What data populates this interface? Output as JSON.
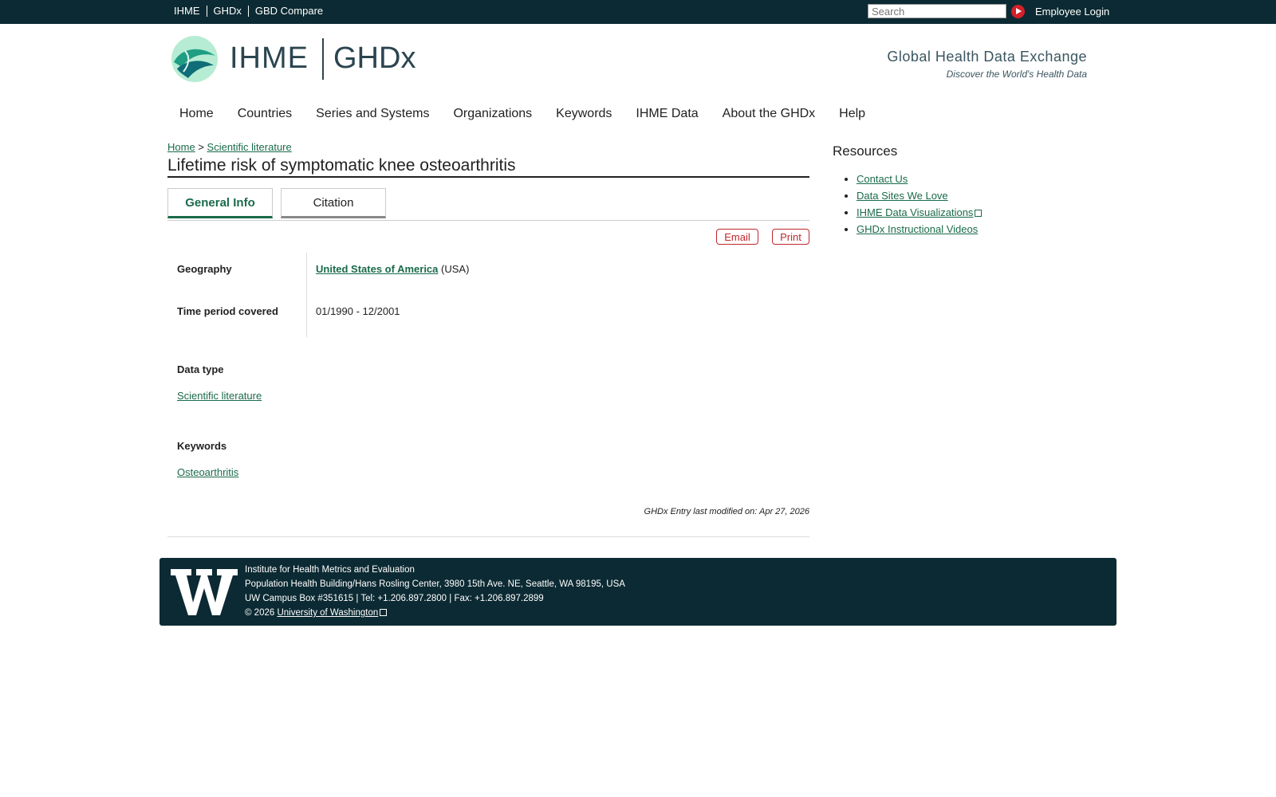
{
  "topbar": {
    "links": [
      "IHME",
      "GHDx",
      "GBD Compare"
    ],
    "search_placeholder": "Search",
    "employee_login": "Employee Login"
  },
  "header": {
    "brand_left": "IHME",
    "brand_right": "GHDx",
    "tagline": "Global Health Data Exchange",
    "subtagline": "Discover the World's Health Data"
  },
  "nav": {
    "items": [
      "Home",
      "Countries",
      "Series and Systems",
      "Organizations",
      "Keywords",
      "IHME Data",
      "About the GHDx",
      "Help"
    ]
  },
  "breadcrumb": {
    "home": "Home",
    "separator": ">",
    "current": "Scientific literature"
  },
  "page": {
    "title": "Lifetime risk of symptomatic knee osteoarthritis",
    "tabs": [
      "General Info",
      "Citation"
    ],
    "email_label": "Email",
    "print_label": "Print",
    "geography_label": "Geography",
    "geography_value": "United States of America",
    "geography_suffix": "(USA)",
    "time_label": "Time period covered",
    "time_value": "01/1990 - 12/2001",
    "datatype_label": "Data type",
    "datatype_value": "Scientific literature",
    "keywords_label": "Keywords",
    "keywords_value": "Osteoarthritis",
    "last_modified": "GHDx Entry last modified on: Apr 27, 2026"
  },
  "sidebar": {
    "title": "Resources",
    "items": [
      "Contact Us",
      "Data Sites We Love",
      "IHME Data Visualizations",
      "GHDx Instructional Videos"
    ]
  },
  "footer": {
    "line1": "Institute for Health Metrics and Evaluation",
    "line2": "Population Health Building/Hans Rosling Center, 3980 15th Ave. NE, Seattle, WA 98195, USA",
    "line3": "UW Campus Box #351615 | Tel: +1.206.897.2800 | Fax: +1.206.897.2899",
    "copyright": "© 2026",
    "uw_link": "University of Washington"
  },
  "colors": {
    "topbar": "#0c2a33",
    "link_green": "#1a6b4a",
    "button_red": "#c0272d"
  }
}
